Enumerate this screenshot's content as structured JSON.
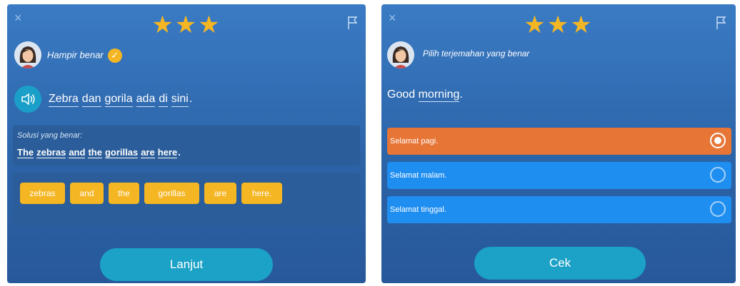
{
  "left": {
    "close_icon": "×",
    "stars": "★★★",
    "feedback_text": "Hampir benar",
    "check_icon": "✓",
    "sentence_words": [
      "Zebra",
      "dan",
      "gorila",
      "ada",
      "di",
      "sini"
    ],
    "sentence_end": ".",
    "solution_label": "Solusi yang benar:",
    "solution_words": [
      "The",
      "zebras",
      "and",
      "the",
      "gorillas",
      "are",
      "here"
    ],
    "solution_end": ".",
    "tiles": [
      "zebras",
      "and",
      "the",
      "gorillas",
      "are",
      "here."
    ],
    "button_label": "Lanjut"
  },
  "right": {
    "close_icon": "×",
    "stars": "★★★",
    "instruction_text": "Pilih terjemahan yang benar",
    "prompt_first": "Good",
    "prompt_word": "morning",
    "prompt_end": ".",
    "options": [
      {
        "label": "Selamat pagi.",
        "selected": true
      },
      {
        "label": "Selamat malam.",
        "selected": false
      },
      {
        "label": "Selamat tinggal.",
        "selected": false
      }
    ],
    "button_label": "Cek"
  },
  "colors": {
    "star": "#f5b623",
    "tile": "#f5b623",
    "button": "#1ba2c6",
    "option_selected": "#e67536",
    "option_default": "#1f8ef1"
  }
}
